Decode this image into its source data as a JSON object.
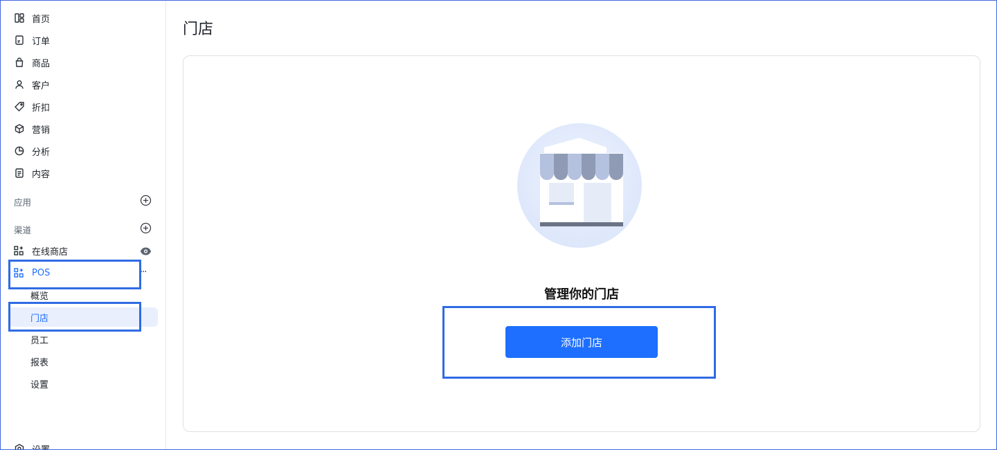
{
  "sidebar": {
    "items": [
      {
        "label": "首页",
        "icon": "home-grid-icon"
      },
      {
        "label": "订单",
        "icon": "order-document-icon"
      },
      {
        "label": "商品",
        "icon": "shopping-bag-icon"
      },
      {
        "label": "客户",
        "icon": "person-icon"
      },
      {
        "label": "折扣",
        "icon": "tag-icon"
      },
      {
        "label": "营销",
        "icon": "cube-icon"
      },
      {
        "label": "分析",
        "icon": "pie-chart-icon"
      },
      {
        "label": "内容",
        "icon": "content-document-icon"
      }
    ],
    "apps_title": "应用",
    "channels_title": "渠道",
    "channels": {
      "online_store": "在线商店",
      "pos": "POS",
      "pos_more": "···"
    },
    "pos_sub": [
      {
        "label": "概览"
      },
      {
        "label": "门店"
      },
      {
        "label": "员工"
      },
      {
        "label": "报表"
      },
      {
        "label": "设置"
      }
    ],
    "settings_label": "设置"
  },
  "main": {
    "title": "门店",
    "empty_title": "管理你的门店",
    "add_button": "添加门店"
  },
  "colors": {
    "accent": "#1e6fff",
    "highlight_box": "#2f6be4",
    "active_bg": "#e9effd"
  }
}
